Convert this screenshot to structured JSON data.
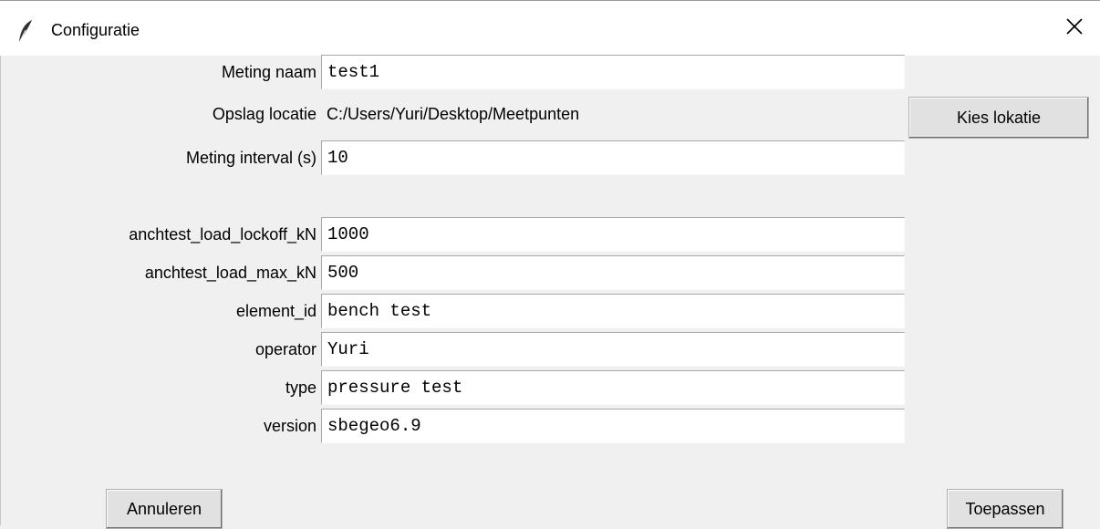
{
  "window": {
    "title": "Configuratie",
    "app_icon": "feather-icon",
    "close_icon": "close-icon"
  },
  "fields": {
    "meting_naam": {
      "label": "Meting naam",
      "value": "test1"
    },
    "opslag_locatie": {
      "label": "Opslag locatie",
      "value": "C:/Users/Yuri/Desktop/Meetpunten",
      "button": "Kies lokatie"
    },
    "meting_interval": {
      "label": "Meting interval (s)",
      "value": "10"
    },
    "load_lockoff": {
      "label": "anchtest_load_lockoff_kN",
      "value": "1000"
    },
    "load_max": {
      "label": "anchtest_load_max_kN",
      "value": "500"
    },
    "element_id": {
      "label": "element_id",
      "value": "bench test"
    },
    "operator": {
      "label": "operator",
      "value": "Yuri"
    },
    "type": {
      "label": "type",
      "value": "pressure test"
    },
    "version": {
      "label": "version",
      "value": "sbegeo6.9"
    }
  },
  "buttons": {
    "cancel": "Annuleren",
    "apply": "Toepassen"
  }
}
